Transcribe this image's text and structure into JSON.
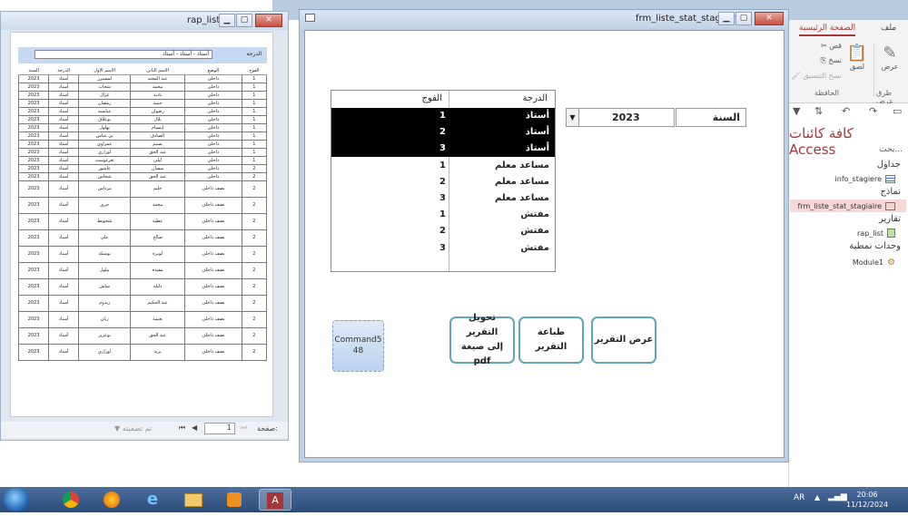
{
  "access": {
    "tabs": {
      "file": "ملف",
      "home": "الصفحة الرئيسية"
    },
    "ribbon": {
      "view": "عرض",
      "views_section": "طرق عرض",
      "paste": "لصق",
      "cut": "قص",
      "copy": "نسخ",
      "format_painter": "نسخ التنسيق",
      "clipboard_section": "الحافظة"
    },
    "nav": {
      "title": "كافة كائنات Access",
      "search": "بحث...",
      "group_tables": "جداول",
      "table_1": "info_stagiere",
      "group_forms": "نماذج",
      "form_1": "frm_liste_stat_stagiaire",
      "group_reports": "تقارير",
      "report_1": "rap_list",
      "group_modules": "وحدات نمطية",
      "module_1": "Module1"
    }
  },
  "report": {
    "title": "rap_list",
    "filter_label": "الدرجة",
    "filter_value": "أستاذ - أستاذ - أستاذ",
    "columns": [
      "السنة",
      "الدرجة",
      "الاسم الاول",
      "الاسم الثاني",
      "الوضع",
      "الفوج"
    ],
    "rows": [
      [
        "2023",
        "أستاذ",
        "لمسيرر",
        "عبد المجيد",
        "داخلي",
        "1"
      ],
      [
        "2023",
        "أستاذ",
        "شحاب",
        "محمد",
        "داخلي",
        "1"
      ],
      [
        "2023",
        "أستاذ",
        "غزال",
        "نادية",
        "داخلي",
        "1"
      ],
      [
        "2023",
        "أستاذ",
        "رمضان",
        "حبيبة",
        "داخلي",
        "1"
      ],
      [
        "2023",
        "أستاذ",
        "عبابسة",
        "رضوان",
        "داخلي",
        "1"
      ],
      [
        "2023",
        "أستاذ",
        "بوعلاق",
        "بلال",
        "داخلي",
        "1"
      ],
      [
        "2023",
        "أستاذ",
        "بهلول",
        "إبتسام",
        "داخلي",
        "1"
      ],
      [
        "2023",
        "أستاذ",
        "بن عباس",
        "الصادق",
        "داخلي",
        "1"
      ],
      [
        "2023",
        "أستاذ",
        "عمراوي",
        "نسيم",
        "داخلي",
        "1"
      ],
      [
        "2023",
        "أستاذ",
        "لوراري",
        "عبد الحق",
        "داخلي",
        "1"
      ],
      [
        "2023",
        "أستاذ",
        "تغرغوست",
        "ليلى",
        "داخلي",
        "1"
      ],
      [
        "2023",
        "أستاذ",
        "عاشور",
        "سفيان",
        "داخلي",
        "2"
      ],
      [
        "2023",
        "أستاذ",
        "شخاس",
        "عبد الحق",
        "داخلي",
        "2"
      ],
      [
        "2023",
        "أستاذ",
        "مرداس",
        "حليم",
        "نصف داخلي",
        "2"
      ],
      [
        "2023",
        "أستاذ",
        "جري",
        "محمد",
        "نصف داخلي",
        "2"
      ],
      [
        "2023",
        "أستاذ",
        "شحويط",
        "عطية",
        "نصف داخلي",
        "2"
      ],
      [
        "2023",
        "أستاذ",
        "علي",
        "صالح",
        "نصف داخلي",
        "2"
      ],
      [
        "2023",
        "أستاذ",
        "بوشكة",
        "لويزة",
        "نصف داخلي",
        "2"
      ],
      [
        "2023",
        "أستاذ",
        "بيلول",
        "مفيدة",
        "نصف داخلي",
        "2"
      ],
      [
        "2023",
        "أستاذ",
        "ساش",
        "دليلة",
        "نصف داخلي",
        "2"
      ],
      [
        "2023",
        "أستاذ",
        "زيدوم",
        "عبد الحكيم",
        "نصف داخلي",
        "2"
      ],
      [
        "2023",
        "أستاذ",
        "زيان",
        "نعيمة",
        "نصف داخلي",
        "2"
      ],
      [
        "2023",
        "أستاذ",
        "بوعزيز",
        "عبد الحق",
        "نصف داخلي",
        "2"
      ],
      [
        "2023",
        "أستاذ",
        "لوراري",
        "يزيد",
        "نصف داخلي",
        "2"
      ]
    ],
    "status_page_label": "صفحة:",
    "status_page_value": "1",
    "status_filter": "تم تصفيته"
  },
  "form": {
    "title": "frm_liste_stat_stagiaire",
    "year_label": "السنة",
    "year_value": "2023",
    "list_headers": {
      "degree": "الدرجة",
      "group": "الفوج"
    },
    "list_rows": [
      {
        "degree": "أستاذ",
        "group": "1",
        "selected": true
      },
      {
        "degree": "أستاذ",
        "group": "2",
        "selected": true
      },
      {
        "degree": "أستاذ",
        "group": "3",
        "selected": true
      },
      {
        "degree": "مساعد معلم",
        "group": "1",
        "selected": false
      },
      {
        "degree": "مساعد معلم",
        "group": "2",
        "selected": false
      },
      {
        "degree": "مساعد معلم",
        "group": "3",
        "selected": false
      },
      {
        "degree": "مفتش",
        "group": "1",
        "selected": false
      },
      {
        "degree": "مفتش",
        "group": "2",
        "selected": false
      },
      {
        "degree": "مفتش",
        "group": "3",
        "selected": false
      }
    ],
    "buttons": {
      "show_report": "عرض التقرير",
      "print_report": "طباعة التقرير",
      "pdf_line1": "تحويل التقرير",
      "pdf_line2": "إلى صيغة pdf",
      "command5_line1": "Command5",
      "command5_line2": "48"
    }
  },
  "taskbar": {
    "lang": "AR",
    "time": "20:06",
    "date": "11/12/2024",
    "apps": [
      "chrome-icon",
      "firefox-icon",
      "ie-icon",
      "explorer-icon",
      "media-icon",
      "access-icon"
    ]
  }
}
